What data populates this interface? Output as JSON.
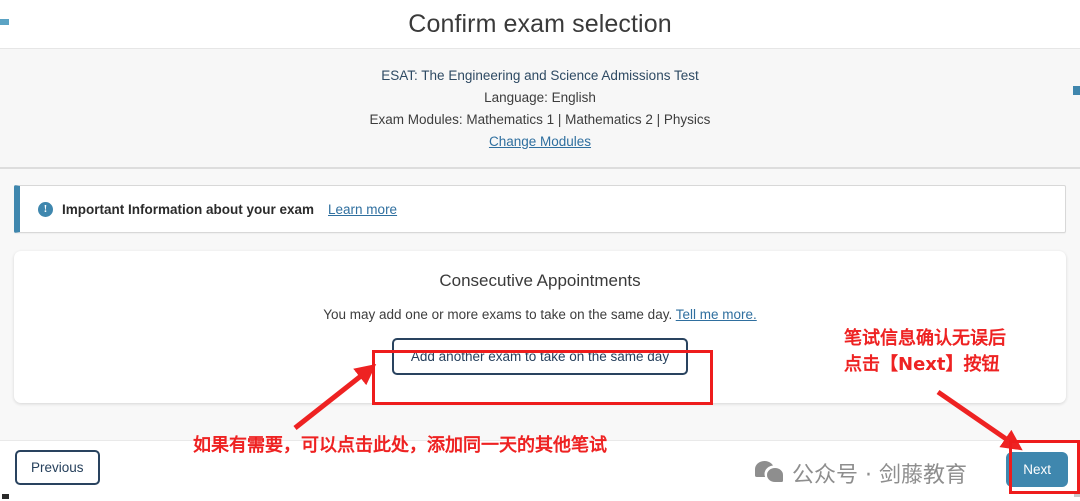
{
  "header": {
    "title": "Confirm exam selection"
  },
  "exam_summary": {
    "exam_name": "ESAT: The Engineering and Science Admissions Test",
    "language": "Language: English",
    "modules": "Exam Modules: Mathematics 1 | Mathematics 2 | Physics",
    "change_modules_link": "Change Modules"
  },
  "info_banner": {
    "icon": "info-circle-icon",
    "text": "Important Information about your exam",
    "learn_more_link": "Learn more",
    "accent_color": "#3f87ae"
  },
  "consecutive_appointments": {
    "title": "Consecutive Appointments",
    "subtitle": "You may add one or more exams to take on the same day.",
    "tell_me_more_link": "Tell me more.",
    "add_exam_button": "Add another exam to take on the same day"
  },
  "footer": {
    "previous_button": "Previous",
    "next_button": "Next"
  },
  "watermark": {
    "icon": "wechat-icon",
    "text": "公众号 · 剑藤教育",
    "color": "#8e8e8e"
  },
  "annotations": {
    "color": "#ee2222",
    "right_note_line1": "笔试信息确认无误后",
    "right_note_line2": "点击【Next】按钮",
    "bottom_note": "如果有需要，可以点击此处，添加同一天的其他笔试"
  }
}
